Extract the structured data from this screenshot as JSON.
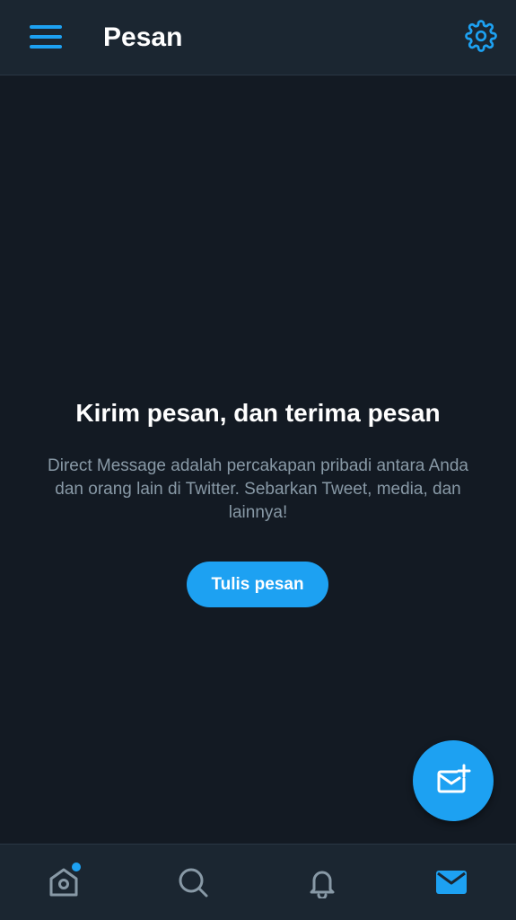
{
  "header": {
    "title": "Pesan",
    "menu_icon": "hamburger-menu-icon",
    "settings_icon": "gear-icon"
  },
  "empty_state": {
    "title": "Kirim pesan, dan terima pesan",
    "description": "Direct Message adalah percakapan pribadi antara Anda dan orang lain di Twitter. Sebarkan Tweet, media, dan lainnya!",
    "button_label": "Tulis pesan"
  },
  "fab": {
    "icon": "new-message-icon"
  },
  "bottom_nav": {
    "items": [
      {
        "name": "home",
        "icon": "home-icon",
        "has_notification_dot": true
      },
      {
        "name": "search",
        "icon": "search-icon",
        "has_notification_dot": false
      },
      {
        "name": "notifications",
        "icon": "bell-icon",
        "has_notification_dot": false
      },
      {
        "name": "messages",
        "icon": "envelope-icon",
        "active": true
      }
    ]
  },
  "colors": {
    "accent": "#1da1f2",
    "background": "#131a23",
    "bar": "#1b2631",
    "secondary_text": "#8899a6"
  }
}
